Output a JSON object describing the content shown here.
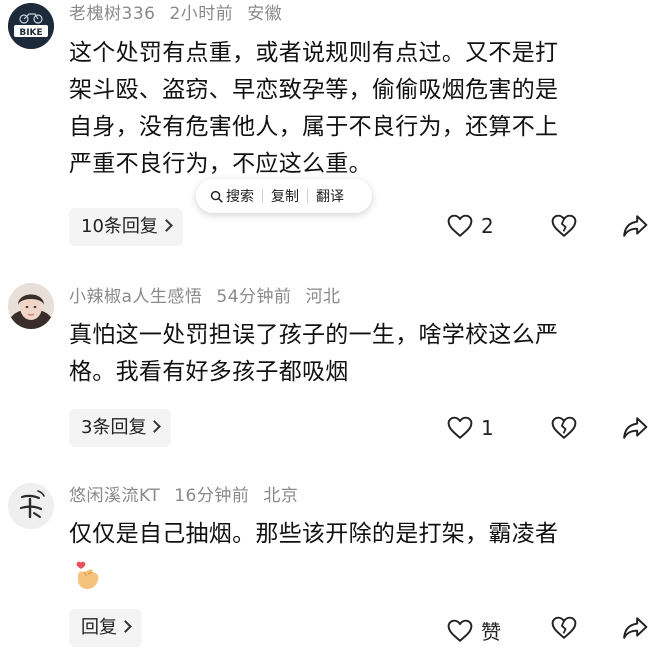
{
  "comments": [
    {
      "username": "老槐树336",
      "time": "2小时前",
      "location": "安徽",
      "avatar_text": "BIKE",
      "text": "这个处罚有点重，或者说规则有点过。又不是打\n架斗殴、盗窃、早恋致孕等，偷偷吸烟危害的是\n自身，没有危害他人，属于不良行为，还算不上\n严重不良行为，不应这么重。",
      "reply_label": "10条回复",
      "like_count": "2"
    },
    {
      "username": "小辣椒a人生感悟",
      "time": "54分钟前",
      "location": "河北",
      "text": "真怕这一处罚担误了孩子的一生，啥学校这么严\n格。我看有好多孩子都吸烟",
      "reply_label": "3条回复",
      "like_count": "1"
    },
    {
      "username": "悠闲溪流KT",
      "time": "16分钟前",
      "location": "北京",
      "text": "仅仅是自己抽烟。那些该开除的是打架，霸凌者",
      "reply_label": "回复",
      "like_count": "赞"
    }
  ],
  "popup": {
    "search": "搜索",
    "copy": "复制",
    "translate": "翻译"
  },
  "colors": {
    "meta": "#8a8a8a",
    "text": "#111111",
    "reply_bg": "#f4f4f4"
  },
  "icons": [
    "heart-icon",
    "broken-heart-icon",
    "share-icon",
    "search-icon",
    "finger-heart-emoji"
  ]
}
